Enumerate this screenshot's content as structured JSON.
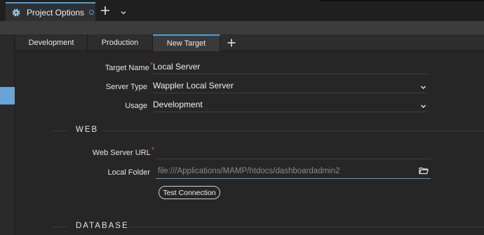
{
  "window_tab": {
    "title": "Project Options",
    "icon": "gear-icon"
  },
  "sub_tabs": [
    {
      "label": "Development"
    },
    {
      "label": "Production"
    },
    {
      "label": "New Target"
    }
  ],
  "form": {
    "target_name": {
      "label": "Target Name",
      "value": "Local Server",
      "required_mark": "*"
    },
    "server_type": {
      "label": "Server Type",
      "value": "Wappler Local Server"
    },
    "usage": {
      "label": "Usage",
      "value": "Development"
    }
  },
  "web": {
    "section_title": "WEB",
    "web_server_url": {
      "label": "Web Server URL",
      "value": "",
      "required_mark": "*"
    },
    "local_folder": {
      "label": "Local Folder",
      "value": "file:///Applications/MAMP/htdocs/dashboardadmin2"
    },
    "test_button": "Test Connection"
  },
  "database": {
    "section_title": "DATABASE"
  },
  "colors": {
    "accent": "#4a9fdc",
    "required": "#e0463a",
    "background": "#262626"
  }
}
